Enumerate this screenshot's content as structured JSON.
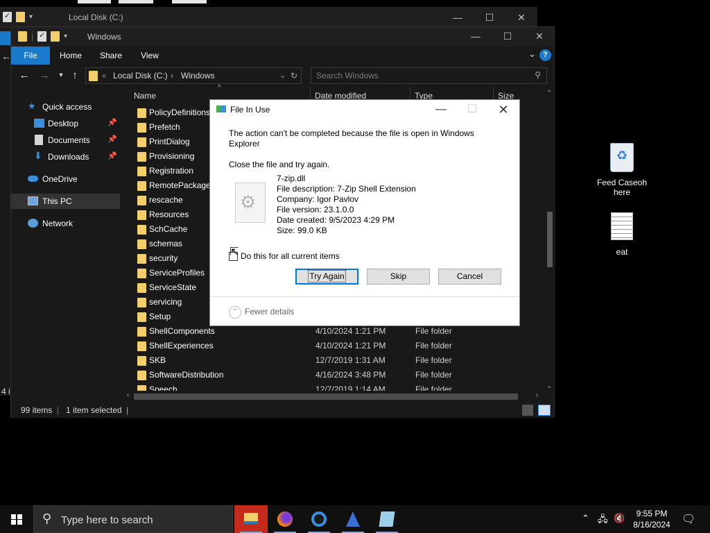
{
  "background_window": {
    "title": "Local Disk (C:)"
  },
  "explorer": {
    "title": "Windows",
    "ribbon_tabs": [
      "File",
      "Home",
      "Share",
      "View"
    ],
    "help_label": "?",
    "address": {
      "root": "Local Disk (C:)",
      "current": "Windows",
      "separator": "›",
      "overflow": "«"
    },
    "search_placeholder": "Search Windows",
    "sidebar": {
      "quick_access": "Quick access",
      "desktop": "Desktop",
      "documents": "Documents",
      "downloads": "Downloads",
      "onedrive": "OneDrive",
      "this_pc": "This PC",
      "network": "Network"
    },
    "columns": {
      "name": "Name",
      "date_modified": "Date modified",
      "type": "Type",
      "size": "Size"
    },
    "rows": [
      {
        "name": "PolicyDefinitions",
        "date": "",
        "type": ""
      },
      {
        "name": "Prefetch",
        "date": "",
        "type": ""
      },
      {
        "name": "PrintDialog",
        "date": "",
        "type": ""
      },
      {
        "name": "Provisioning",
        "date": "",
        "type": ""
      },
      {
        "name": "Registration",
        "date": "",
        "type": ""
      },
      {
        "name": "RemotePackages",
        "date": "",
        "type": ""
      },
      {
        "name": "rescache",
        "date": "",
        "type": ""
      },
      {
        "name": "Resources",
        "date": "",
        "type": ""
      },
      {
        "name": "SchCache",
        "date": "",
        "type": ""
      },
      {
        "name": "schemas",
        "date": "",
        "type": ""
      },
      {
        "name": "security",
        "date": "",
        "type": ""
      },
      {
        "name": "ServiceProfiles",
        "date": "",
        "type": ""
      },
      {
        "name": "ServiceState",
        "date": "",
        "type": ""
      },
      {
        "name": "servicing",
        "date": "",
        "type": ""
      },
      {
        "name": "Setup",
        "date": "",
        "type": ""
      },
      {
        "name": "ShellComponents",
        "date": "4/10/2024 1:21 PM",
        "type": "File folder"
      },
      {
        "name": "ShellExperiences",
        "date": "4/10/2024 1:21 PM",
        "type": "File folder"
      },
      {
        "name": "SKB",
        "date": "12/7/2019 1:31 AM",
        "type": "File folder"
      },
      {
        "name": "SoftwareDistribution",
        "date": "4/16/2024 3:48 PM",
        "type": "File folder"
      },
      {
        "name": "Speech",
        "date": "12/7/2019 1:14 AM",
        "type": "File folder"
      }
    ],
    "status": {
      "count": "99 items",
      "selected": "1 item selected"
    }
  },
  "dialog": {
    "title": "File In Use",
    "message_line1": "The action can't be completed because the file is open in Windows",
    "message_line2": "Explorer",
    "instruction": "Close the file and try again.",
    "file_name": "7-zip.dll",
    "file_description": "File description: 7-Zip Shell Extension",
    "company": "Company: Igor Pavlov",
    "file_version": "File version: 23.1.0.0",
    "date_created": "Date created: 9/5/2023 4:29 PM",
    "size": "Size: 99.0 KB",
    "checkbox_label": "Do this for all current items",
    "try_again": "Try Again",
    "skip": "Skip",
    "cancel": "Cancel",
    "fewer_details": "Fewer details"
  },
  "desktop_icons": {
    "recycle_label_1": "Feed Caseoh",
    "recycle_label_2": "here",
    "file_label": "eat"
  },
  "taskbar": {
    "search_placeholder": "Type here to search",
    "time": "9:55 PM",
    "date": "8/16/2024"
  },
  "colors": {
    "accent": "#1979ca",
    "folder": "#f3cf6b",
    "dark_bg": "#191919"
  }
}
